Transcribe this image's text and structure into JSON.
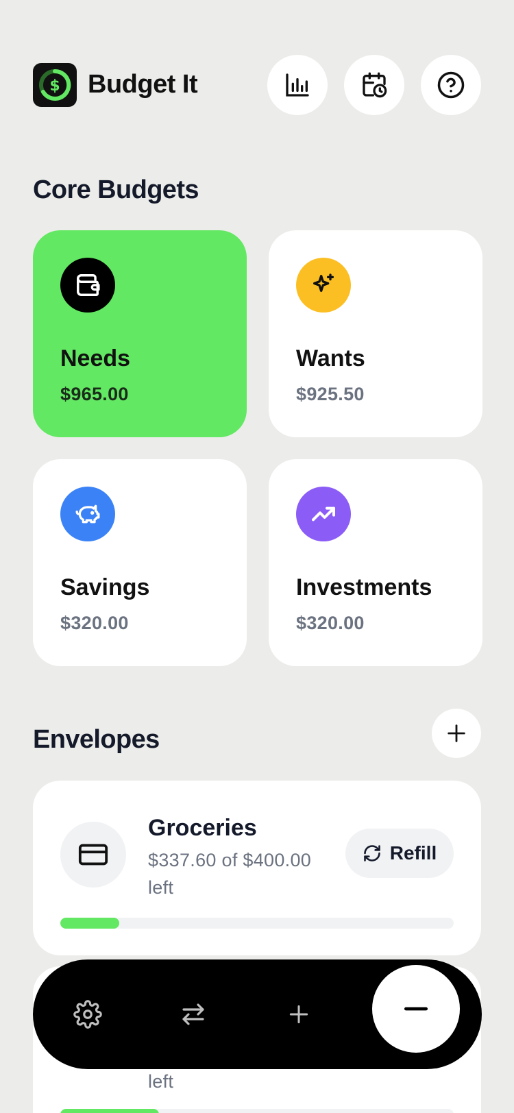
{
  "app": {
    "title": "Budget It"
  },
  "header": {
    "icons": [
      "chart-icon",
      "calendar-clock-icon",
      "help-icon"
    ]
  },
  "core_budgets": {
    "title": "Core Budgets",
    "cards": [
      {
        "name": "Needs",
        "amount": "$965.00",
        "icon": "wallet-icon",
        "color": "#000000",
        "active": true
      },
      {
        "name": "Wants",
        "amount": "$925.50",
        "icon": "sparkle-icon",
        "color": "#FBBF24",
        "active": false
      },
      {
        "name": "Savings",
        "amount": "$320.00",
        "icon": "piggy-bank-icon",
        "color": "#3B82F6",
        "active": false
      },
      {
        "name": "Investments",
        "amount": "$320.00",
        "icon": "trending-up-icon",
        "color": "#8B5CF6",
        "active": false
      }
    ]
  },
  "envelopes": {
    "title": "Envelopes",
    "items": [
      {
        "name": "Groceries",
        "remaining": "$337.60 of $400.00 left",
        "refill_label": "Refill",
        "progress": 0.15
      },
      {
        "name": "",
        "remaining": "left",
        "refill_label": "",
        "progress": 0.25
      }
    ]
  },
  "colors": {
    "accent": "#62E862",
    "background": "#ECEDEA",
    "bar": "#000000"
  }
}
